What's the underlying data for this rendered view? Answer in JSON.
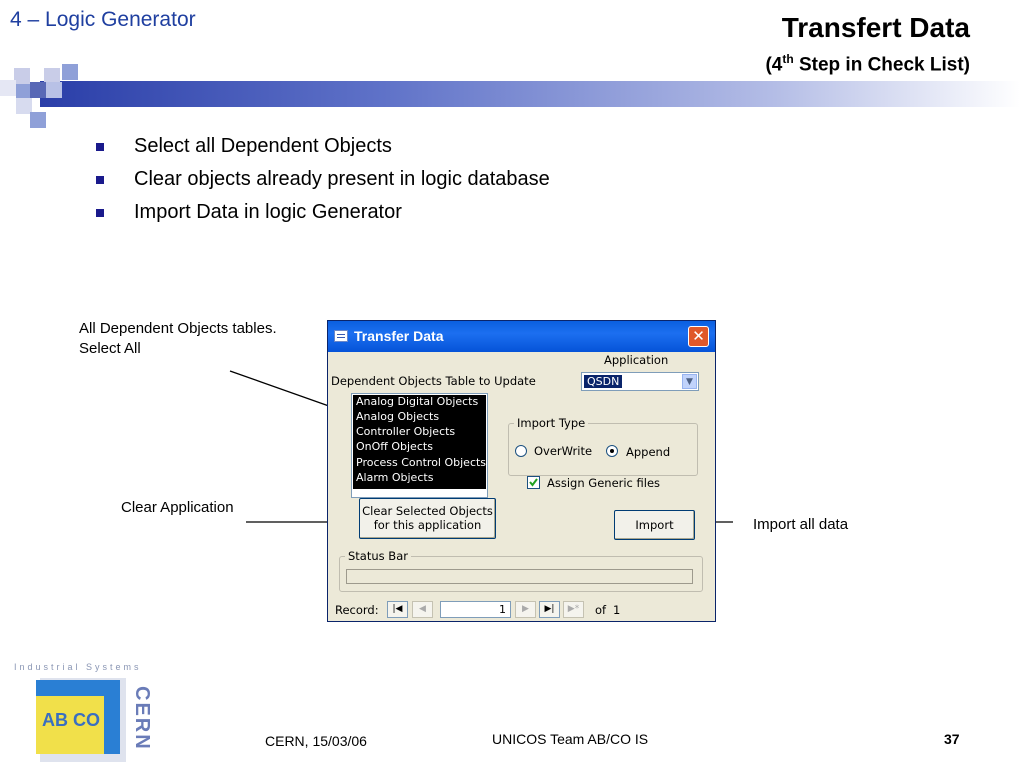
{
  "slide": {
    "section_title": "4 – Logic Generator",
    "title": "Transfert Data",
    "subtitle_prefix": "(4",
    "subtitle_sup": "th",
    "subtitle_suffix": " Step in Check List)",
    "bullets": [
      "Select all Dependent Objects",
      "Clear objects already present in logic database",
      "Import Data in logic Generator"
    ],
    "annotations": {
      "dependent_objects": [
        "All Dependent Objects tables.",
        "Select All"
      ],
      "clear_application": "Clear Application",
      "import_all": "Import all data"
    },
    "colors": {
      "section_title": "#1f3fa0",
      "band": "#2a3ea8",
      "bullet": "#1a1a8c"
    }
  },
  "dialog": {
    "title": "Transfer Data",
    "close_glyph": "✕",
    "application_label": "Application",
    "application_value": "QSDN",
    "table_label": "Dependent Objects Table to Update",
    "list_items": [
      "Analog Digital Objects",
      "Analog Objects",
      "Controller Objects",
      "OnOff Objects",
      "Process Control Objects",
      "Alarm Objects"
    ],
    "import_type": {
      "label": "Import Type",
      "options": [
        "OverWrite",
        "Append"
      ],
      "selected": "Append"
    },
    "assign_generic_label": "Assign Generic files",
    "assign_generic_checked": true,
    "clear_button_line1": "Clear Selected Objects",
    "clear_button_line2": "for this application",
    "import_button": "Import",
    "status_bar_label": "Status Bar",
    "record": {
      "label": "Record:",
      "current": "1",
      "of_label": "of",
      "total": "1"
    }
  },
  "footer": {
    "date": "CERN, 15/03/06",
    "team": "UNICOS Team AB/CO IS",
    "page": "37"
  },
  "logo": {
    "top_text": "Industrial Systems",
    "group_text": "AB CO",
    "org_text": "CERN"
  }
}
